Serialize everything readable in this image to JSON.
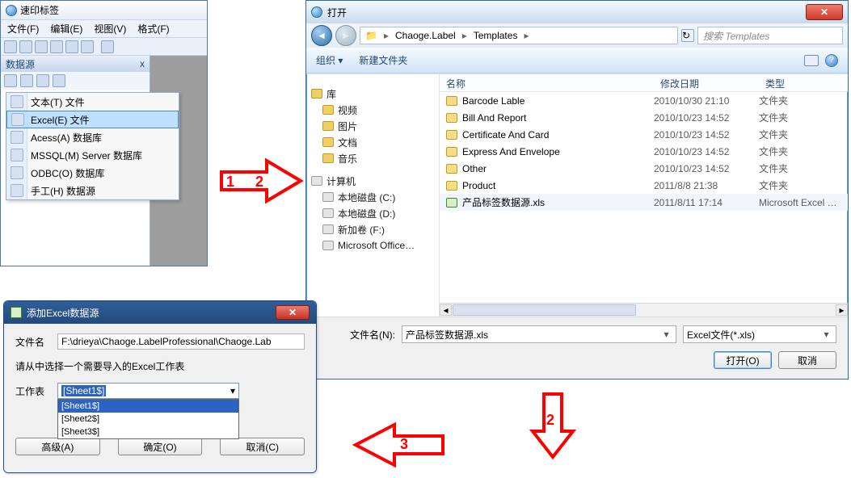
{
  "app1": {
    "title": "速印标签",
    "menus": [
      "文件(F)",
      "编辑(E)",
      "视图(V)",
      "格式(F)"
    ],
    "datasource_panel": {
      "header": "数据源",
      "close": "x"
    },
    "menu_items": [
      {
        "label": "文本(T) 文件"
      },
      {
        "label": "Excel(E) 文件"
      },
      {
        "label": "Acess(A) 数据库"
      },
      {
        "label": "MSSQL(M) Server 数据库"
      },
      {
        "label": "ODBC(O) 数据库"
      },
      {
        "label": "手工(H) 数据源"
      }
    ],
    "selected_index": 1
  },
  "app2": {
    "title": "打开",
    "breadcrumb": [
      "Chaoge.Label",
      "Templates"
    ],
    "search_placeholder": "搜索 Templates",
    "toolbar": {
      "organize": "组织 ▾",
      "new_folder": "新建文件夹"
    },
    "tree": {
      "lib": {
        "label": "库",
        "children": [
          "视频",
          "图片",
          "文档",
          "音乐"
        ]
      },
      "computer": {
        "label": "计算机",
        "children": [
          "本地磁盘 (C:)",
          "本地磁盘 (D:)",
          "新加卷 (F:)",
          "Microsoft Office…"
        ]
      }
    },
    "columns": {
      "name": "名称",
      "date": "修改日期",
      "type": "类型"
    },
    "files": [
      {
        "name": "Barcode Lable",
        "date": "2010/10/30 21:10",
        "type": "文件夹",
        "kind": "folder"
      },
      {
        "name": "Bill And Report",
        "date": "2010/10/23 14:52",
        "type": "文件夹",
        "kind": "folder"
      },
      {
        "name": "Certificate And Card",
        "date": "2010/10/23 14:52",
        "type": "文件夹",
        "kind": "folder"
      },
      {
        "name": "Express And Envelope",
        "date": "2010/10/23 14:52",
        "type": "文件夹",
        "kind": "folder"
      },
      {
        "name": "Other",
        "date": "2010/10/23 14:52",
        "type": "文件夹",
        "kind": "folder"
      },
      {
        "name": "Product",
        "date": "2011/8/8 21:38",
        "type": "文件夹",
        "kind": "folder"
      },
      {
        "name": "产品标签数据源.xls",
        "date": "2011/8/11 17:14",
        "type": "Microsoft Excel …",
        "kind": "xls"
      }
    ],
    "file_name_label": "文件名(N):",
    "file_name_value": "产品标签数据源.xls",
    "filter": "Excel文件(*.xls)",
    "open_btn": "打开(O)",
    "cancel_btn": "取消"
  },
  "app3": {
    "title": "添加Excel数据源",
    "file_label": "文件名",
    "file_value": "F:\\drieya\\Chaoge.LabelProfessional\\Chaoge.Lab",
    "hint": "请从中选择一个需要导入的Excel工作表",
    "sheet_label": "工作表",
    "sheet_value": "[Sheet1$]",
    "sheet_options": [
      "[Sheet1$]",
      "[Sheet2$]",
      "[Sheet3$]"
    ],
    "sheet_selected_index": 0,
    "adv_btn": "高级(A)",
    "ok_btn": "确定(O)",
    "cancel_btn": "取消(C)"
  },
  "annotations": {
    "step1": "1",
    "step2": "2",
    "step3": "3",
    "step2b": "2"
  }
}
